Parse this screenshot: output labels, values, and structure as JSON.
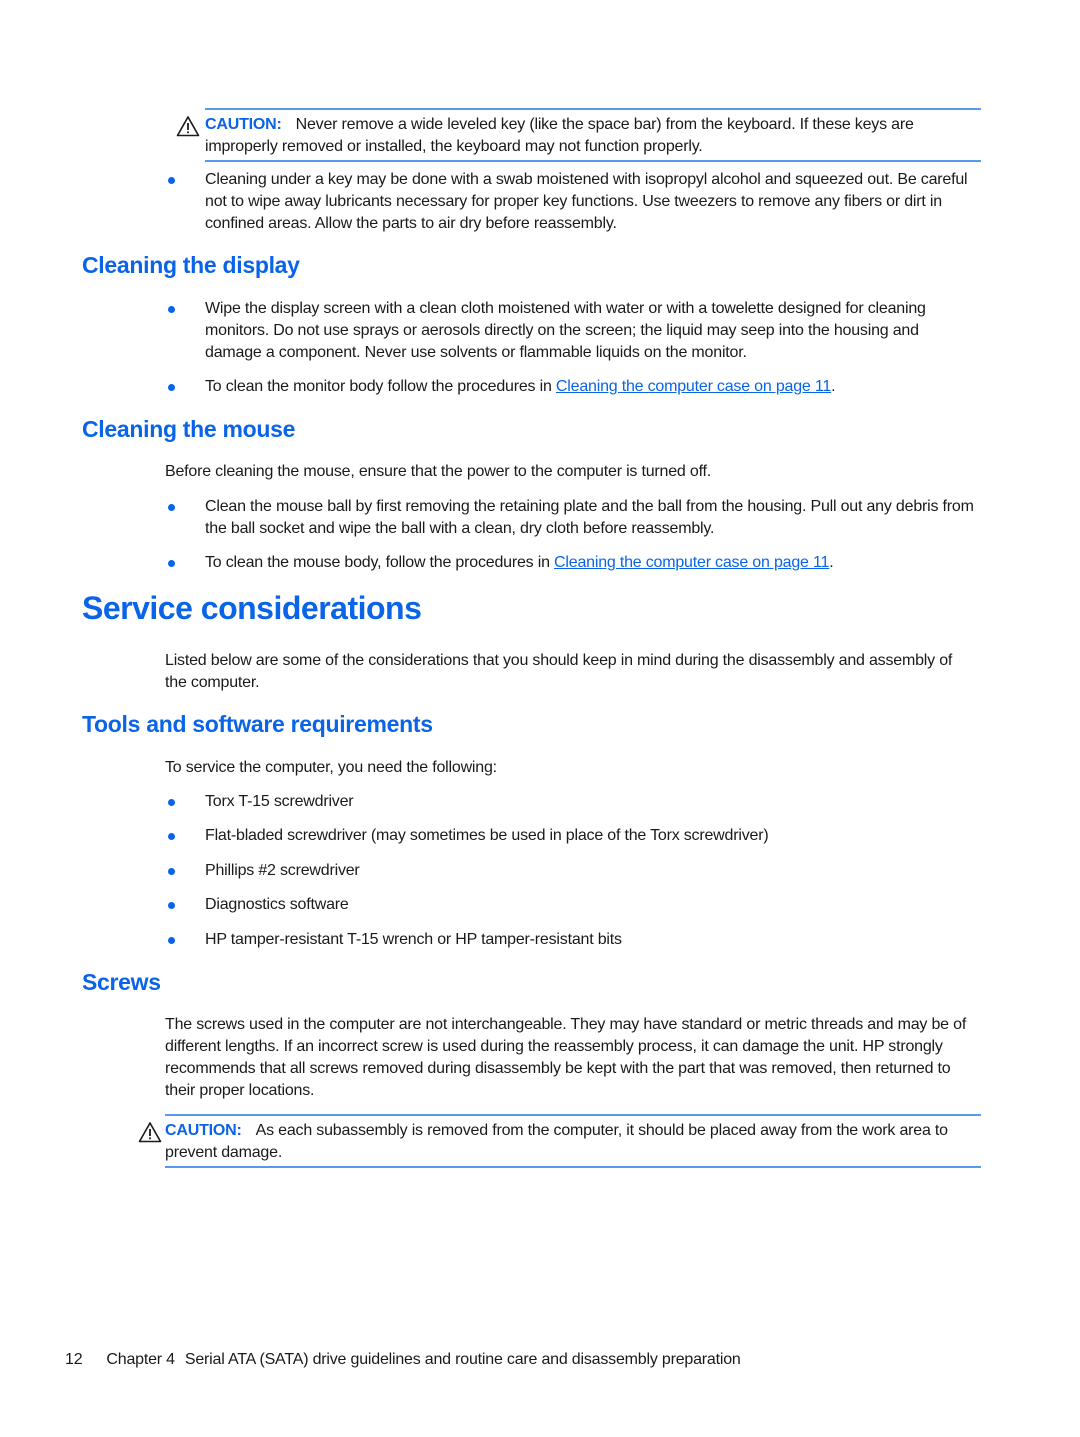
{
  "colors": {
    "accent": "#0a64e8",
    "rule": "#5b97ec",
    "text": "#1a1a1a"
  },
  "caution_top": {
    "icon": "warning-triangle-icon",
    "label": "CAUTION:",
    "text": "Never remove a wide leveled key (like the space bar) from the keyboard. If these keys are improperly removed or installed, the keyboard may not function properly."
  },
  "keyboard_bullet": "Cleaning under a key may be done with a swab moistened with isopropyl alcohol and squeezed out. Be careful not to wipe away lubricants necessary for proper key functions. Use tweezers to remove any fibers or dirt in confined areas. Allow the parts to air dry before reassembly.",
  "cleaning_display": {
    "heading": "Cleaning the display",
    "bullets": [
      "Wipe the display screen with a clean cloth moistened with water or with a towelette designed for cleaning monitors. Do not use sprays or aerosols directly on the screen; the liquid may seep into the housing and damage a component. Never use solvents or flammable liquids on the monitor."
    ],
    "link_bullet": {
      "prefix": "To clean the monitor body follow the procedures in ",
      "link": "Cleaning the computer case on page 11",
      "suffix": "."
    }
  },
  "cleaning_mouse": {
    "heading": "Cleaning the mouse",
    "intro": "Before cleaning the mouse, ensure that the power to the computer is turned off.",
    "bullets": [
      "Clean the mouse ball by first removing the retaining plate and the ball from the housing. Pull out any debris from the ball socket and wipe the ball with a clean, dry cloth before reassembly."
    ],
    "link_bullet": {
      "prefix": "To clean the mouse body, follow the procedures in ",
      "link": "Cleaning the computer case on page 11",
      "suffix": "."
    }
  },
  "service": {
    "heading": "Service considerations",
    "intro": "Listed below are some of the considerations that you should keep in mind during the disassembly and assembly of the computer."
  },
  "tools": {
    "heading": "Tools and software requirements",
    "intro": "To service the computer, you need the following:",
    "items": [
      "Torx T-15 screwdriver",
      "Flat-bladed screwdriver (may sometimes be used in place of the Torx screwdriver)",
      "Phillips #2 screwdriver",
      "Diagnostics software",
      "HP tamper-resistant T-15 wrench or HP tamper-resistant bits"
    ]
  },
  "screws": {
    "heading": "Screws",
    "text": "The screws used in the computer are not interchangeable. They may have standard or metric threads and may be of different lengths. If an incorrect screw is used during the reassembly process, it can damage the unit. HP strongly recommends that all screws removed during disassembly be kept with the part that was removed, then returned to their proper locations.",
    "caution": {
      "icon": "warning-triangle-icon",
      "label": "CAUTION:",
      "text": "As each subassembly is removed from the computer, it should be placed away from the work area to prevent damage."
    }
  },
  "footer": {
    "page_number": "12",
    "chapter": "Chapter 4",
    "title": "Serial ATA (SATA) drive guidelines and routine care and disassembly preparation"
  }
}
